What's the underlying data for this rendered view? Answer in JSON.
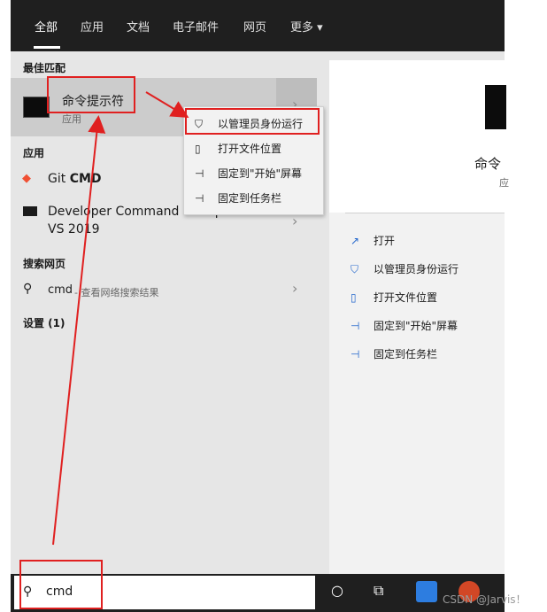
{
  "tabs": [
    "全部",
    "应用",
    "文档",
    "电子邮件",
    "网页",
    "更多"
  ],
  "best_match": {
    "section": "最佳匹配",
    "title": "命令提示符",
    "subtitle": "应用"
  },
  "apps_section": "应用",
  "apps": [
    {
      "name_prefix": "Git ",
      "name_bold": "CMD"
    },
    {
      "name_line1": "Developer Command Prompt for",
      "name_line2": "VS 2019"
    }
  ],
  "web_section": "搜索网页",
  "web_result": {
    "query": "cmd",
    "hint": " - 查看网络搜索结果"
  },
  "settings_section": "设置 (1)",
  "context_menu": [
    "以管理员身份运行",
    "打开文件位置",
    "固定到\"开始\"屏幕",
    "固定到任务栏"
  ],
  "right_panel": {
    "title": "命令",
    "subtitle": "应",
    "actions": [
      "打开",
      "以管理员身份运行",
      "打开文件位置",
      "固定到\"开始\"屏幕",
      "固定到任务栏"
    ]
  },
  "search": {
    "value": "cmd"
  },
  "watermark": "CSDN @Jarvis！",
  "colors": {
    "annotation": "#e02020",
    "accent": "#2266cc",
    "taskbar": "#1f1f1f"
  }
}
